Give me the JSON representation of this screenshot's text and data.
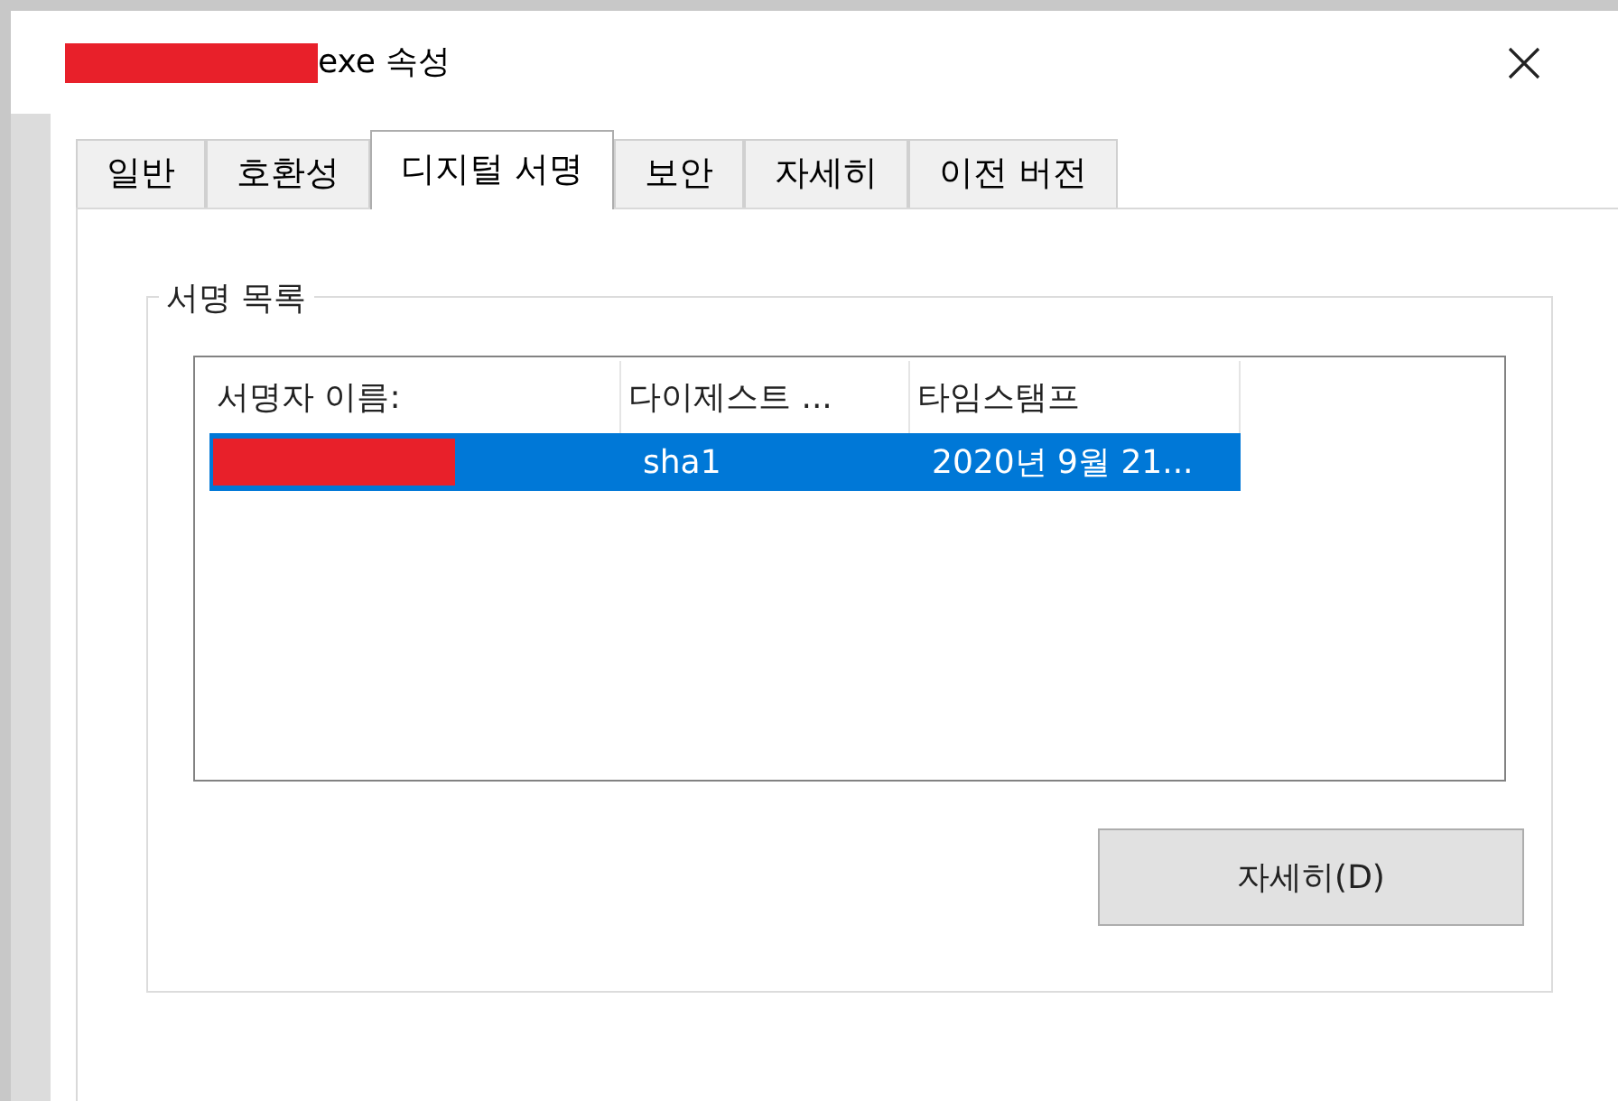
{
  "window": {
    "title": "exe 속성",
    "title_redacted": true
  },
  "tabs": [
    {
      "label": "일반",
      "selected": false
    },
    {
      "label": "호환성",
      "selected": false
    },
    {
      "label": "디지털 서명",
      "selected": true
    },
    {
      "label": "보안",
      "selected": false
    },
    {
      "label": "자세히",
      "selected": false
    },
    {
      "label": "이전 버전",
      "selected": false
    }
  ],
  "signature_list": {
    "title": "서명 목록",
    "columns": [
      "서명자 이름:",
      "다이제스트 ...",
      "타임스탬프"
    ],
    "rows": [
      {
        "selected": true,
        "cells": [
          {
            "text": "",
            "redacted": true
          },
          {
            "text": "sha1",
            "redacted": false
          },
          {
            "text": "2020년 9월 21...",
            "redacted": false
          }
        ]
      }
    ]
  },
  "buttons": [
    "자세히(D)"
  ]
}
